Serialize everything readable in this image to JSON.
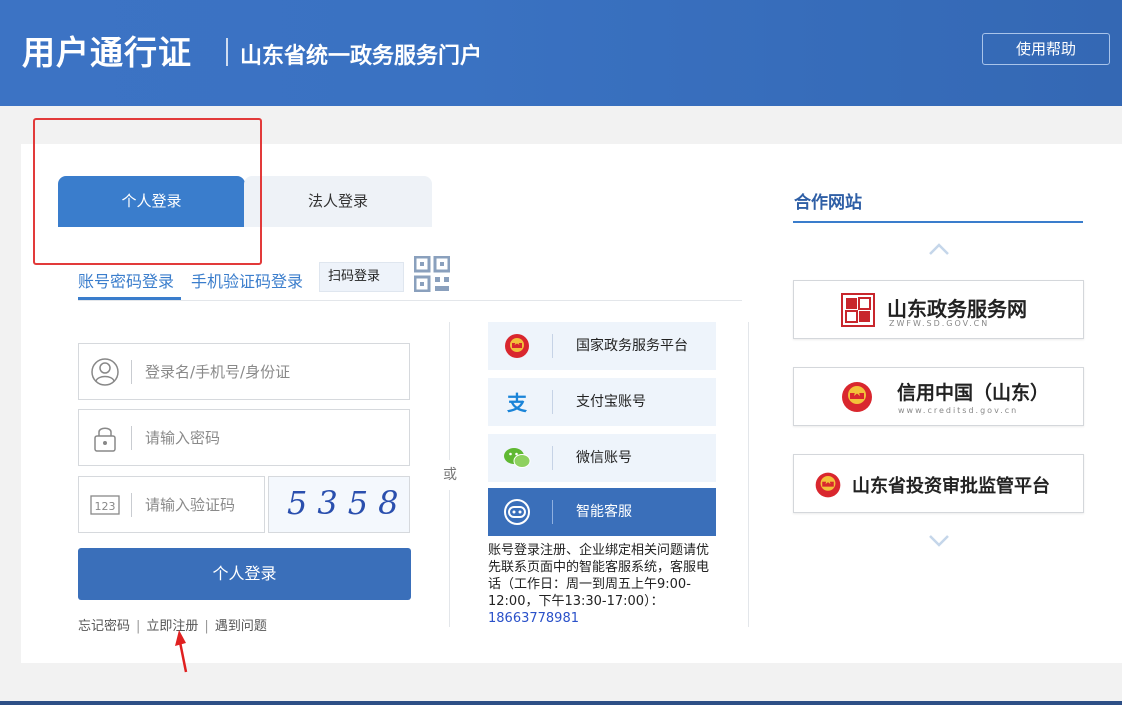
{
  "header": {
    "brand": "用户通行证",
    "subtitle": "山东省统一政务服务门户",
    "help_label": "使用帮助"
  },
  "tabs": [
    {
      "label": "个人登录",
      "active": true
    },
    {
      "label": "法人登录",
      "active": false
    }
  ],
  "login_methods": {
    "account_password": "账号密码登录",
    "sms_code": "手机验证码登录",
    "qr_scan": "扫码登录"
  },
  "form": {
    "username_placeholder": "登录名/手机号/身份证",
    "password_placeholder": "请输入密码",
    "captcha_placeholder": "请输入验证码",
    "captcha_text": "5358",
    "submit_label": "个人登录"
  },
  "links": {
    "forgot": "忘记密码",
    "register": "立即注册",
    "problem": "遇到问题"
  },
  "or_label": "或",
  "alt_logins": [
    {
      "label": "国家政务服务平台",
      "icon": "national-emblem-icon"
    },
    {
      "label": "支付宝账号",
      "icon": "alipay-icon"
    },
    {
      "label": "微信账号",
      "icon": "wechat-icon"
    },
    {
      "label": "智能客服",
      "icon": "chatbot-icon"
    }
  ],
  "support": {
    "text": "账号登录注册、企业绑定相关问题请优先联系页面中的智能客服系统，客服电话（工作日：周一到周五上午9:00-12:00，下午13:30-17:00）：",
    "phone": "18663778981"
  },
  "partners": {
    "title": "合作网站",
    "items": [
      {
        "name": "山东政务服务网",
        "sub": "ZWFW.SD.GOV.CN"
      },
      {
        "name": "信用中国（山东）",
        "sub": "www.creditsd.gov.cn"
      },
      {
        "name": "山东省投资审批监管平台",
        "sub": ""
      }
    ]
  },
  "colors": {
    "primary": "#3a7dcc",
    "button": "#3a6fba",
    "highlight": "#e23a3a"
  }
}
